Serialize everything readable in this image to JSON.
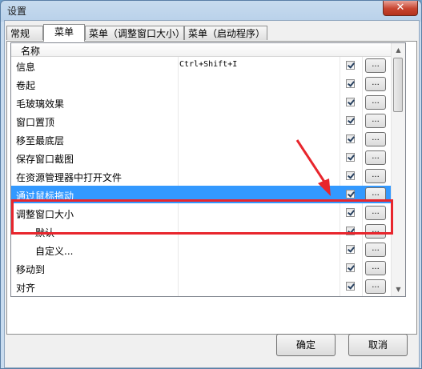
{
  "window": {
    "title": "设置",
    "close_label": "✕"
  },
  "tabs": [
    {
      "label": "常规",
      "active": false
    },
    {
      "label": "菜单",
      "active": true
    },
    {
      "label": "菜单（调整窗口大小）",
      "active": false
    },
    {
      "label": "菜单（启动程序）",
      "active": false
    }
  ],
  "list": {
    "header": "名称",
    "rows": [
      {
        "name": "信息",
        "shortcut": "Ctrl+Shift+I",
        "checked": true,
        "button": "..."
      },
      {
        "name": "卷起",
        "shortcut": "",
        "checked": true,
        "button": "..."
      },
      {
        "name": "毛玻璃效果",
        "shortcut": "",
        "checked": true,
        "button": "..."
      },
      {
        "name": "窗口置顶",
        "shortcut": "",
        "checked": true,
        "button": "..."
      },
      {
        "name": "移至最底层",
        "shortcut": "",
        "checked": true,
        "button": "..."
      },
      {
        "name": "保存窗口截图",
        "shortcut": "",
        "checked": true,
        "button": "..."
      },
      {
        "name": "在资源管理器中打开文件",
        "shortcut": "",
        "checked": true,
        "button": "..."
      },
      {
        "name": "通过鼠标拖动",
        "shortcut": "",
        "checked": true,
        "button": "...",
        "selected": true
      },
      {
        "name": "调整窗口大小",
        "shortcut": "",
        "checked": true,
        "button": "..."
      },
      {
        "name": "默认",
        "shortcut": "",
        "checked": true,
        "button": "...",
        "indent": true
      },
      {
        "name": "自定义...",
        "shortcut": "",
        "checked": true,
        "button": "...",
        "indent": true
      },
      {
        "name": "移动到",
        "shortcut": "",
        "checked": true,
        "button": "..."
      },
      {
        "name": "对齐",
        "shortcut": "",
        "checked": true,
        "button": "..."
      }
    ]
  },
  "buttons": {
    "ok": "确定",
    "cancel": "取消"
  },
  "colors": {
    "selection": "#3399ff",
    "highlight_box": "#e8262d"
  }
}
